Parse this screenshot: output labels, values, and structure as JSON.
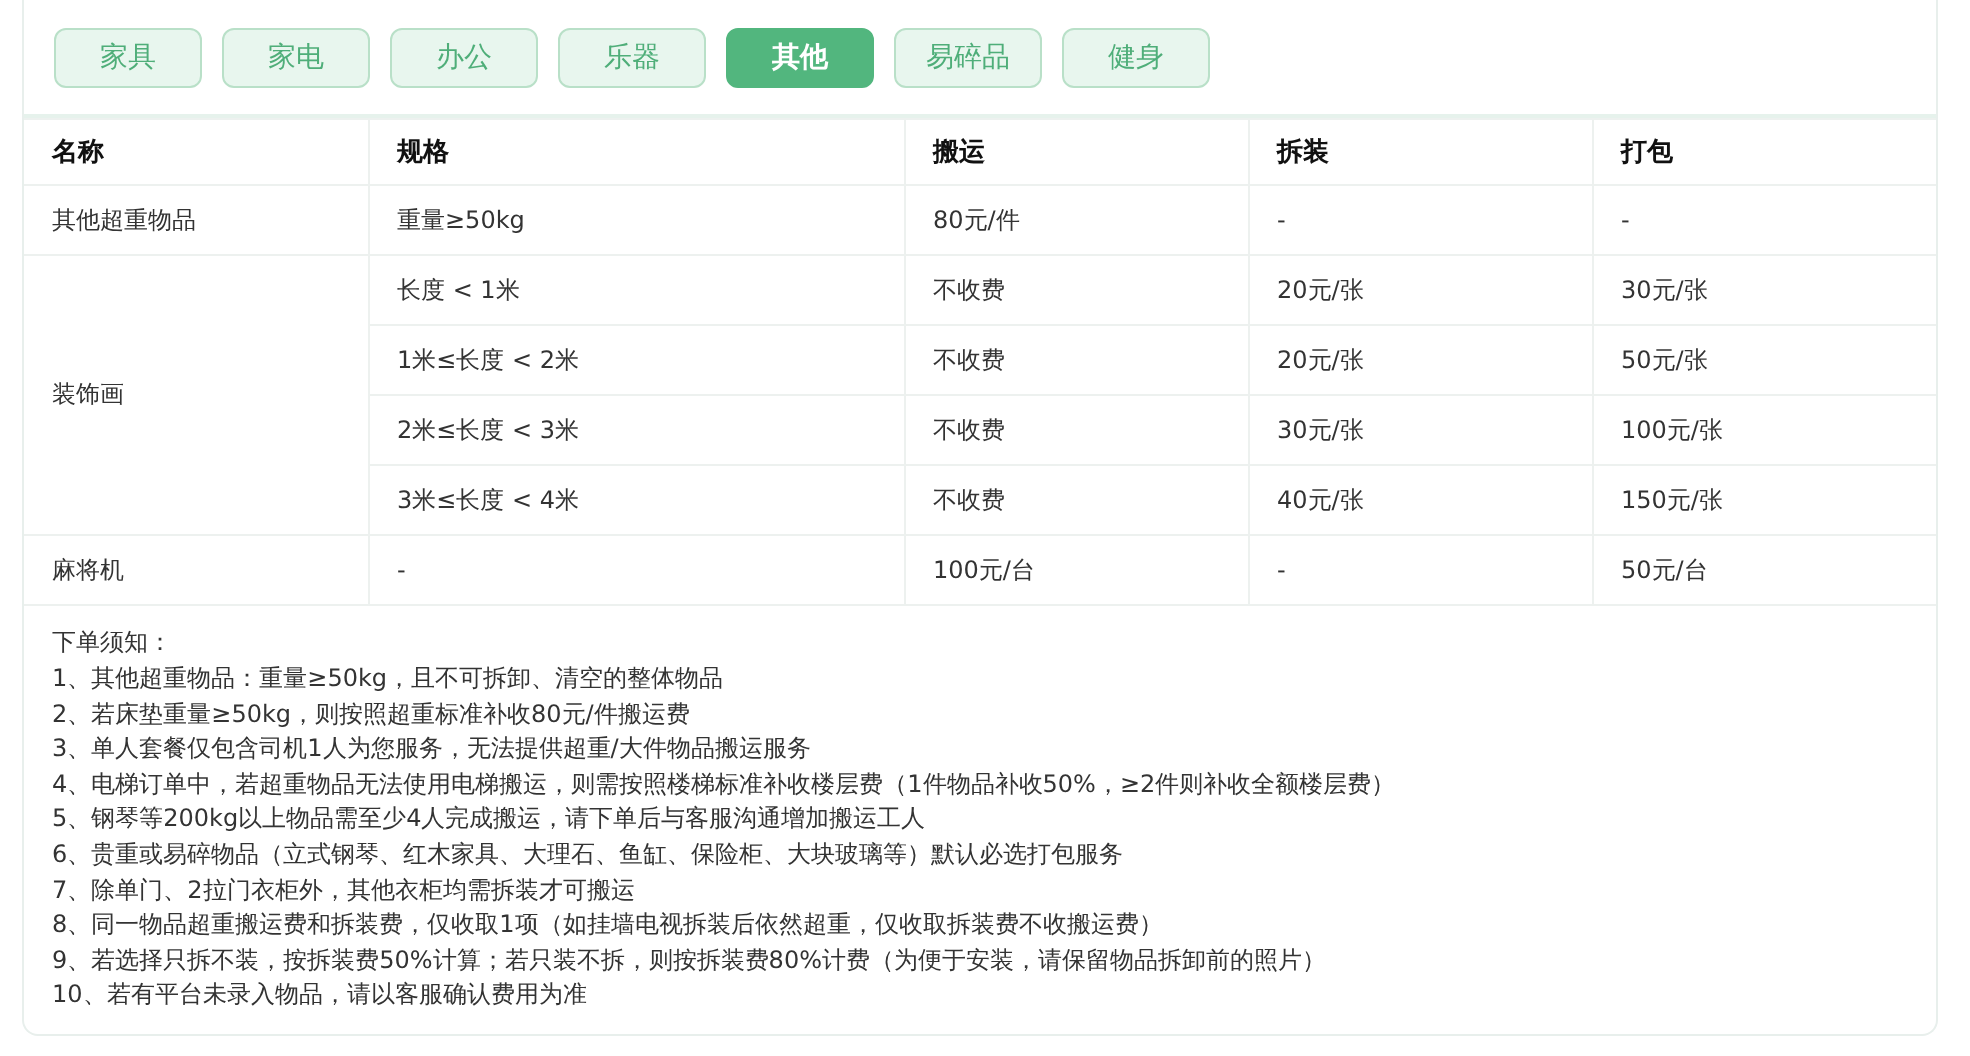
{
  "tabs": [
    {
      "label": "家具",
      "selected": false
    },
    {
      "label": "家电",
      "selected": false
    },
    {
      "label": "办公",
      "selected": false
    },
    {
      "label": "乐器",
      "selected": false
    },
    {
      "label": "其他",
      "selected": true
    },
    {
      "label": "易碎品",
      "selected": false
    },
    {
      "label": "健身",
      "selected": false
    }
  ],
  "table": {
    "columns": [
      "名称",
      "规格",
      "搬运",
      "拆装",
      "打包"
    ],
    "groups": [
      {
        "name": "其他超重物品",
        "rows": [
          [
            "重量≥50kg",
            "80元/件",
            "-",
            "-"
          ]
        ]
      },
      {
        "name": "装饰画",
        "rows": [
          [
            "长度 < 1米",
            "不收费",
            "20元/张",
            "30元/张"
          ],
          [
            "1米≤长度 < 2米",
            "不收费",
            "20元/张",
            "50元/张"
          ],
          [
            "2米≤长度 < 3米",
            "不收费",
            "30元/张",
            "100元/张"
          ],
          [
            "3米≤长度 < 4米",
            "不收费",
            "40元/张",
            "150元/张"
          ]
        ]
      },
      {
        "name": "麻将机",
        "rows": [
          [
            "-",
            "100元/台",
            "-",
            "50元/台"
          ]
        ]
      }
    ]
  },
  "notes": {
    "title": "下单须知：",
    "items": [
      "1、其他超重物品：重量≥50kg，且不可拆卸、清空的整体物品",
      "2、若床垫重量≥50kg，则按照超重标准补收80元/件搬运费",
      "3、单人套餐仅包含司机1人为您服务，无法提供超重/大件物品搬运服务",
      "4、电梯订单中，若超重物品无法使用电梯搬运，则需按照楼梯标准补收楼层费（1件物品补收50%，≥2件则补收全额楼层费）",
      "5、钢琴等200kg以上物品需至少4人完成搬运，请下单后与客服沟通增加搬运工人",
      "6、贵重或易碎物品（立式钢琴、红木家具、大理石、鱼缸、保险柜、大块玻璃等）默认必选打包服务",
      "7、除单门、2拉门衣柜外，其他衣柜均需拆装才可搬运",
      "8、同一物品超重搬运费和拆装费，仅收取1项（如挂墙电视拆装后依然超重，仅收取拆装费不收搬运费）",
      "9、若选择只拆不装，按拆装费50%计算；若只装不拆，则按拆装费80%计费（为便于安装，请保留物品拆卸前的照片）",
      "10、若有平台未录入物品，请以客服确认费用为准"
    ]
  }
}
